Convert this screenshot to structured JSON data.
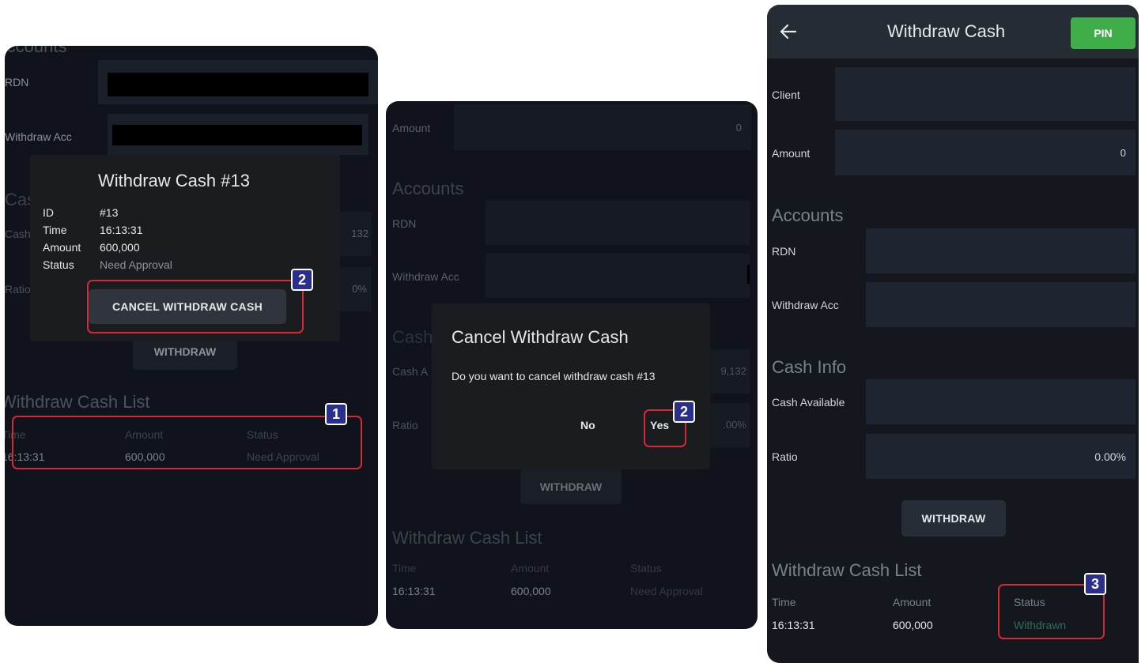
{
  "panel1": {
    "accounts_heading": "Accounts",
    "rdn_label": "RDN",
    "withdraw_acc_label": "Withdraw Acc",
    "cash_heading_partial": "Cas",
    "cash_label_partial": "Cash",
    "ratio_label_partial": "Ratio",
    "cash_value_partial": "132",
    "ratio_value_partial": "0%",
    "withdraw_button": "WITHDRAW",
    "list_heading": "Withdraw Cash List",
    "list_columns": [
      "Time",
      "Amount",
      "Status"
    ],
    "list_row": {
      "time": "16:13:31",
      "amount": "600,000",
      "status": "Need Approval"
    },
    "dialog": {
      "title": "Withdraw Cash #13",
      "rows": [
        {
          "key": "ID",
          "value": "#13"
        },
        {
          "key": "Time",
          "value": "16:13:31"
        },
        {
          "key": "Amount",
          "value": "600,000"
        },
        {
          "key": "Status",
          "value": "Need Approval"
        }
      ],
      "cancel_button": "CANCEL WITHDRAW CASH"
    },
    "badges": [
      "1",
      "2"
    ]
  },
  "panel2": {
    "amount_label": "Amount",
    "amount_value": "0",
    "accounts_heading": "Accounts",
    "rdn_label": "RDN",
    "withdraw_acc_label": "Withdraw Acc",
    "cash_heading_partial": "Cash",
    "cash_label_partial": "Cash A",
    "ratio_label": "Ratio",
    "cash_value_partial": "9,132",
    "ratio_value_partial": ".00%",
    "withdraw_button": "WITHDRAW",
    "list_heading": "Withdraw Cash List",
    "list_columns": [
      "Time",
      "Amount",
      "Status"
    ],
    "list_row": {
      "time": "16:13:31",
      "amount": "600,000",
      "status": "Need Approval"
    },
    "dialog": {
      "title": "Cancel Withdraw Cash",
      "message": "Do you want to cancel withdraw cash #13",
      "no_button": "No",
      "yes_button": "Yes"
    },
    "badge": "2"
  },
  "panel3": {
    "header_title": "Withdraw Cash",
    "back_icon": "arrow-left-icon",
    "pin_button": "PIN",
    "client_label": "Client",
    "amount_label": "Amount",
    "amount_value": "0",
    "accounts_heading": "Accounts",
    "rdn_label": "RDN",
    "withdraw_acc_label": "Withdraw Acc",
    "cash_info_heading": "Cash Info",
    "cash_available_label": "Cash Available",
    "ratio_label": "Ratio",
    "ratio_value": "0.00%",
    "withdraw_button": "WITHDRAW",
    "list_heading": "Withdraw Cash List",
    "list_columns": [
      "Time",
      "Amount",
      "Status"
    ],
    "list_row": {
      "time": "16:13:31",
      "amount": "600,000",
      "status": "Withdrawn"
    },
    "badge": "3"
  },
  "colors": {
    "background": "#11131c",
    "field": "#1a2029",
    "header": "#262c33",
    "pin": "#3fae49",
    "highlight": "#d32b36",
    "badge": "#2a2f8c",
    "withdrawn_status": "#2f6e55"
  }
}
